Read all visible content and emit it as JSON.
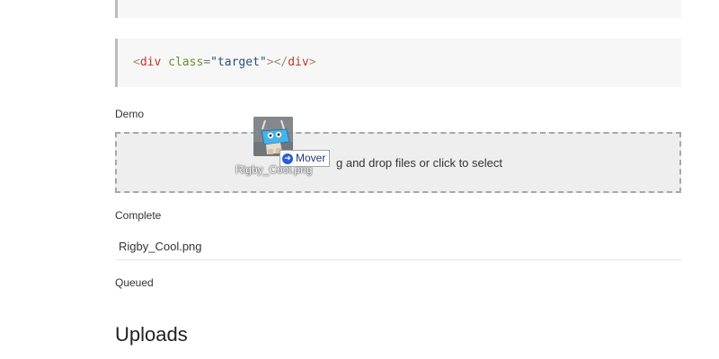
{
  "code_snippet": {
    "open_bracket": "<",
    "tag": "div",
    "space": " ",
    "attr": "class",
    "eq": "=",
    "value": "\"target\"",
    "close_open": ">",
    "close_tag_open": "</",
    "close_tag": "div",
    "close_bracket": ">"
  },
  "demo": {
    "label": "Demo",
    "dropzone_text": "g and drop files or click to select"
  },
  "drag_ghost": {
    "file_name": "Rigby_Cool.png",
    "tooltip": "Mover",
    "arrow_glyph": "➔"
  },
  "complete": {
    "label": "Complete",
    "files": [
      "Rigby_Cool.png"
    ]
  },
  "queued": {
    "label": "Queued"
  },
  "uploads": {
    "heading": "Uploads"
  },
  "colors": {
    "dropzone_bg": "#eeeeee",
    "dropzone_border": "#a7a7a7",
    "code_bg": "#f7f7f7",
    "code_tag": "#c0392b",
    "code_attr": "#6a8f2a",
    "code_string": "#2f4f7a",
    "tooltip_text": "#1f3b7a"
  }
}
